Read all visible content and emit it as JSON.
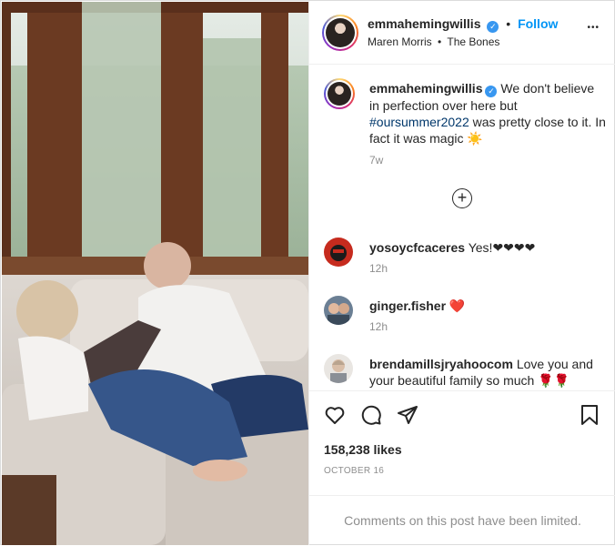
{
  "post": {
    "author": "emmahemingwillis",
    "follow_label": "Follow",
    "dot": "•",
    "audio_artist": "Maren Morris",
    "audio_dot": "•",
    "audio_track": "The Bones",
    "more_label": "•••",
    "caption_prefix": "We don't believe in perfection over here but ",
    "caption_hashtag": "#oursummer2022",
    "caption_suffix": " was pretty close to it. In fact it was magic ☀️",
    "caption_time": "7w",
    "load_more_label": "+"
  },
  "comments": [
    {
      "username": "yosoycfcaceres",
      "text": "Yes!❤❤❤❤",
      "time": "12h"
    },
    {
      "username": "ginger.fisher",
      "text": "❤️",
      "time": "12h"
    },
    {
      "username": "brendamillsjryahoocom",
      "text": "Love you and your beautiful family so much 🌹🌹",
      "time": ""
    }
  ],
  "footer": {
    "likes": "158,238 likes",
    "date": "OCTOBER 16",
    "limited": "Comments on this post have been limited."
  },
  "colors": {
    "accent": "#0095f6",
    "verified": "#3897f0",
    "heart": "#ed4956",
    "hashtag": "#00376b"
  }
}
